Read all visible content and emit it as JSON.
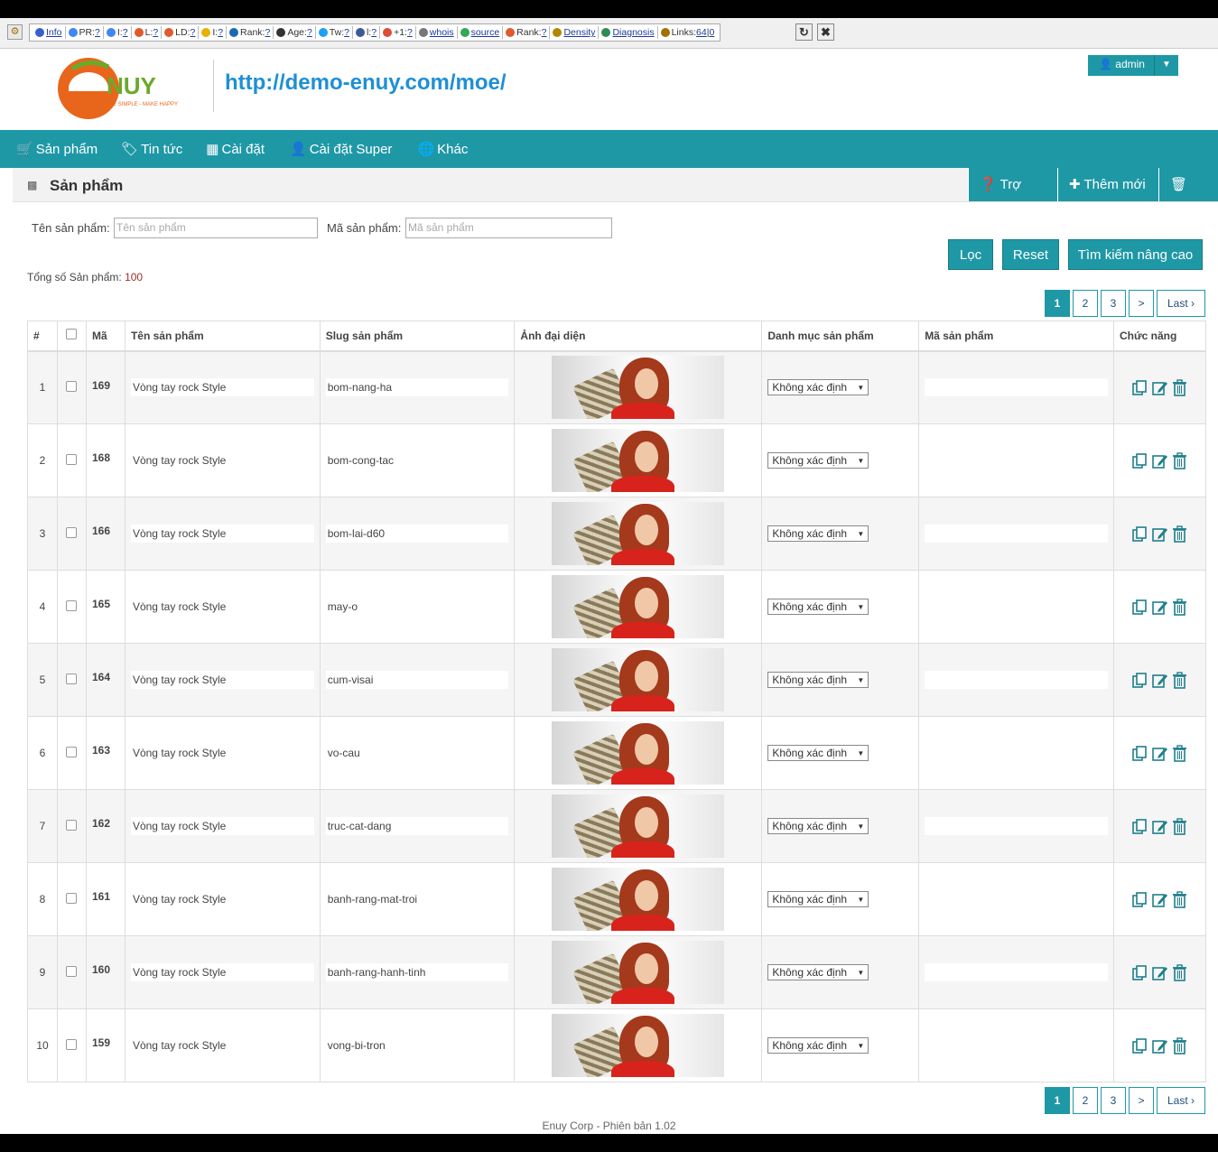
{
  "seobar": {
    "items": [
      {
        "icon": "info-icon",
        "label": "Info",
        "color": "#3a5fcd"
      },
      {
        "icon": "google-icon",
        "label": "PR:",
        "value": "?",
        "color": "#4285f4"
      },
      {
        "icon": "google-icon",
        "label": "I:",
        "value": "?",
        "color": "#4285f4"
      },
      {
        "icon": "majestic-icon",
        "label": "L:",
        "value": "?",
        "color": "#e05a2b"
      },
      {
        "icon": "majestic-icon",
        "label": "LD:",
        "value": "?",
        "color": "#e05a2b"
      },
      {
        "icon": "bing-icon",
        "label": "I:",
        "value": "?",
        "color": "#e8b100"
      },
      {
        "icon": "alexa-icon",
        "label": "Rank:",
        "value": "?",
        "color": "#1a6ab3"
      },
      {
        "icon": "archive-icon",
        "label": "Age:",
        "value": "?",
        "color": "#333333"
      },
      {
        "icon": "twitter-icon",
        "label": "Tw:",
        "value": "?",
        "color": "#1da1f2"
      },
      {
        "icon": "facebook-icon",
        "label": "l:",
        "value": "?",
        "color": "#3b5998"
      },
      {
        "icon": "gplus-icon",
        "label": "+1:",
        "value": "?",
        "color": "#dd4b39"
      },
      {
        "icon": "whois-icon",
        "label": "whois",
        "color": "#777777"
      },
      {
        "icon": "chrome-icon",
        "label": "source",
        "color": "#34a853"
      },
      {
        "icon": "semrush-icon",
        "label": "Rank:",
        "value": "?",
        "color": "#e05a2b"
      },
      {
        "icon": "density-icon",
        "label": "Density",
        "color": "#b38600"
      },
      {
        "icon": "diagnosis-icon",
        "label": "Diagnosis",
        "color": "#2e8b57"
      },
      {
        "icon": "links-icon",
        "label": "Links:",
        "value": "64",
        "value2": "0",
        "color": "#a07000"
      }
    ]
  },
  "header": {
    "site_url": "http://demo-enuy.com/moe/",
    "logo_text": "NUY",
    "logo_tagline": "MAKE SIMPLE - MAKE HAPPY",
    "user": "admin"
  },
  "nav": {
    "items": [
      {
        "label": "Sản phẩm",
        "icon": "cart-icon",
        "glyph": "🛒"
      },
      {
        "label": "Tin tức",
        "icon": "tags-icon",
        "glyph": "🏷"
      },
      {
        "label": "Cài đặt",
        "icon": "grid-icon",
        "glyph": "▦"
      },
      {
        "label": "Cài đặt Super",
        "icon": "user-icon",
        "glyph": "👤"
      },
      {
        "label": "Khác",
        "icon": "globe-icon",
        "glyph": "🌐"
      }
    ]
  },
  "page": {
    "title": "Sản phẩm",
    "buttons": {
      "help": "Trợ giúp",
      "add": "Thêm mới",
      "delete": "Xóa"
    }
  },
  "filters": {
    "name_label": "Tên sản phẩm:",
    "name_placeholder": "Tên sản phẩm",
    "code_label": "Mã sản phẩm:",
    "code_placeholder": "Mã sản phẩm",
    "filter_btn": "Lọc",
    "reset_btn": "Reset",
    "advanced_btn": "Tìm kiếm nâng cao"
  },
  "total": {
    "label": "Tổng số Sản phẩm:",
    "value": "100"
  },
  "pager": {
    "pages": [
      "1",
      "2",
      "3"
    ],
    "active": "1",
    "next": ">",
    "last": "Last ›"
  },
  "table": {
    "headers": {
      "num": "#",
      "id": "Mã",
      "name": "Tên sản phẩm",
      "slug": "Slug sản phẩm",
      "image": "Ảnh đại diện",
      "category": "Danh mục sản phẩm",
      "code": "Mã sản phẩm",
      "actions": "Chức năng"
    },
    "rows": [
      {
        "num": "1",
        "id": "169",
        "name": "Vòng tay rock Style",
        "slug": "bom-nang-ha",
        "category": "Không xác định",
        "code": ""
      },
      {
        "num": "2",
        "id": "168",
        "name": "Vòng tay rock Style",
        "slug": "bom-cong-tac",
        "category": "Không xác định",
        "code": ""
      },
      {
        "num": "3",
        "id": "166",
        "name": "Vòng tay rock Style",
        "slug": "bom-lai-d60",
        "category": "Không xác định",
        "code": ""
      },
      {
        "num": "4",
        "id": "165",
        "name": "Vòng tay rock Style",
        "slug": "may-o",
        "category": "Không xác định",
        "code": ""
      },
      {
        "num": "5",
        "id": "164",
        "name": "Vòng tay rock Style",
        "slug": "cum-visai",
        "category": "Không xác định",
        "code": ""
      },
      {
        "num": "6",
        "id": "163",
        "name": "Vòng tay rock Style",
        "slug": "vo-cau",
        "category": "Không xác định",
        "code": ""
      },
      {
        "num": "7",
        "id": "162",
        "name": "Vòng tay rock Style",
        "slug": "truc-cat-dang",
        "category": "Không xác định",
        "code": ""
      },
      {
        "num": "8",
        "id": "161",
        "name": "Vòng tay rock Style",
        "slug": "banh-rang-mat-troi",
        "category": "Không xác định",
        "code": ""
      },
      {
        "num": "9",
        "id": "160",
        "name": "Vòng tay rock Style",
        "slug": "banh-rang-hanh-tinh",
        "category": "Không xác định",
        "code": ""
      },
      {
        "num": "10",
        "id": "159",
        "name": "Vòng tay rock Style",
        "slug": "vong-bi-tron",
        "category": "Không xác định",
        "code": ""
      }
    ]
  },
  "footer": {
    "text": "Enuy Corp - Phiên bản 1.02"
  },
  "colors": {
    "accent": "#1f98a6",
    "link": "#1f8fd6",
    "logo_orange": "#e8661b",
    "logo_green": "#6aaa2b"
  }
}
